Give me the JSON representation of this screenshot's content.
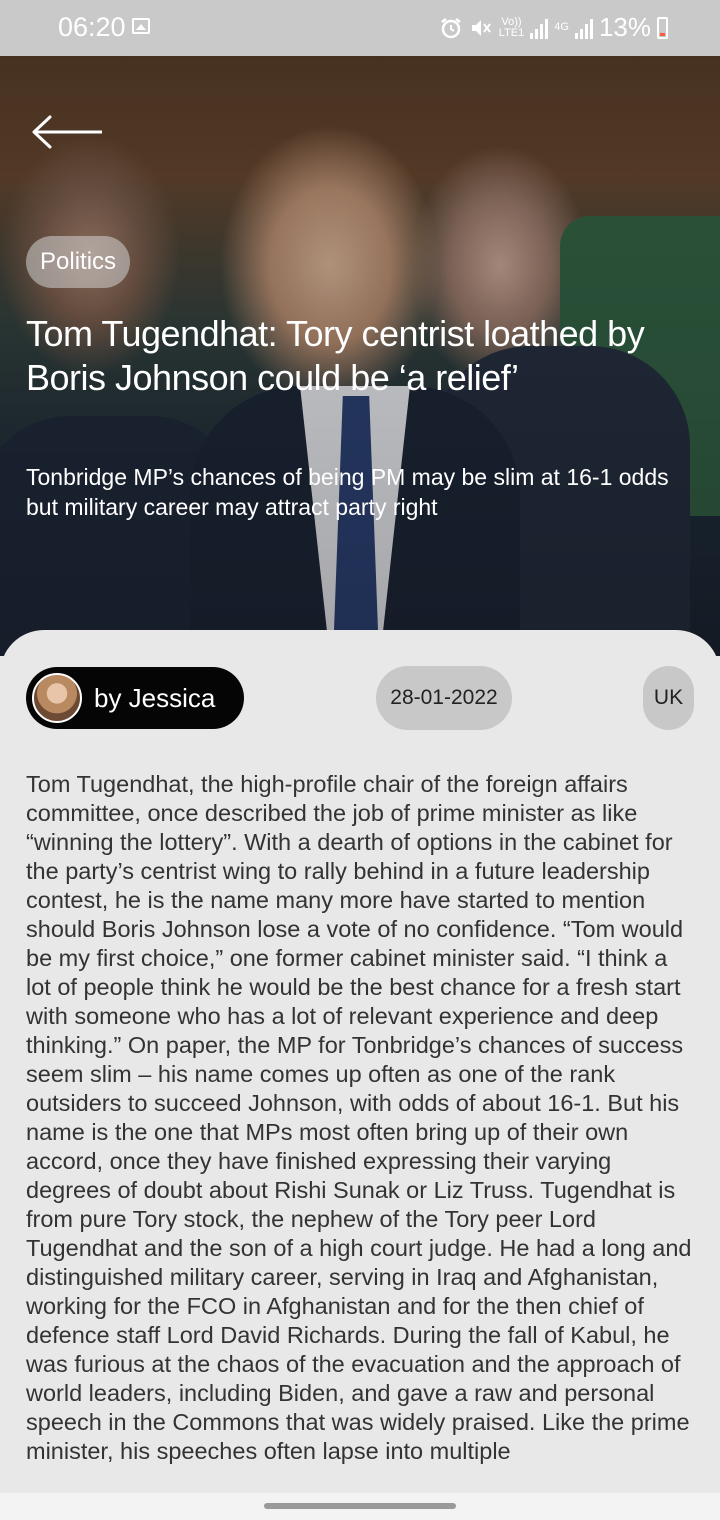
{
  "status_bar": {
    "time": "06:20",
    "net_label_top": "Vo))",
    "net_label_bottom": "LTE1",
    "net_type": "4G",
    "battery_percent": "13%",
    "icons": [
      "gallery-icon",
      "alarm-icon",
      "mute-icon",
      "signal-icon",
      "battery-icon"
    ]
  },
  "article": {
    "category": "Politics",
    "headline": "Tom Tugendhat: Tory centrist loathed by Boris Johnson could be ‘a relief’",
    "subheadline": "Tonbridge MP’s chances of being PM may be slim at 16-1 odds but military career may attract party right",
    "author": "by Jessica",
    "date": "28-01-2022",
    "region": "UK",
    "body": "Tom Tugendhat, the high-profile chair of the foreign affairs committee, once described the job of prime minister as like “winning the lottery”. With a dearth of options in the cabinet for the party’s centrist wing to rally behind in a future leadership contest, he is the name many more have started to mention should Boris Johnson lose a vote of no confidence. “Tom would be my first choice,” one former cabinet minister said. “I think a lot of people think he would be the best chance for a fresh start with someone who has a lot of relevant experience and deep thinking.” On paper, the MP for Tonbridge’s chances of success seem slim – his name comes up often as one of the rank outsiders to succeed Johnson, with odds of about 16-1. But his name is the one that MPs most often bring up of their own accord, once they have finished expressing their varying degrees of doubt about Rishi Sunak or Liz Truss. Tugendhat is from pure Tory stock, the nephew of the Tory peer Lord Tugendhat and the son of a high court judge. He had a long and distinguished military career, serving in Iraq and Afghanistan, working for the FCO in Afghanistan and for the then chief of defence staff Lord David Richards. During the fall of Kabul, he was furious at the chaos of the evacuation and the approach of world leaders, including Biden, and gave a raw and personal speech in the Commons that was widely praised. Like the prime minister, his speeches often lapse into multiple"
  },
  "colors": {
    "status_bar_bg": "#c9c9c9",
    "sheet_bg": "#e9e8e9",
    "author_pill_bg": "#050505",
    "meta_pill_bg": "#c8c8c8",
    "body_text": "#333333"
  }
}
